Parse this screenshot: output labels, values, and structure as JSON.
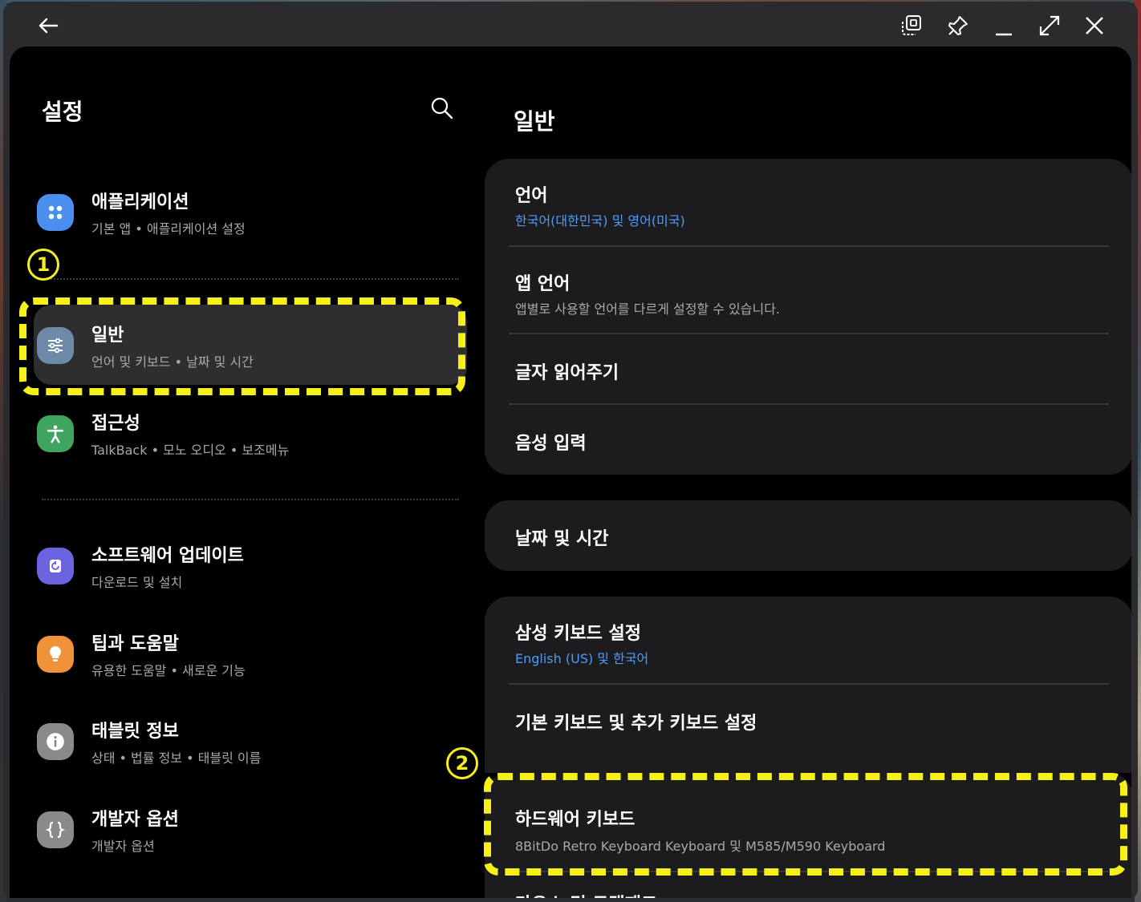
{
  "titlebar": {
    "icons": [
      "back-arrow-icon",
      "screenshot-window-icon",
      "pin-icon",
      "minimize-icon",
      "maximize-icon",
      "close-icon"
    ]
  },
  "left": {
    "title": "설정",
    "items": [
      {
        "title": "애플리케이션",
        "subtitle": "기본 앱  •  애플리케이션 설정",
        "icon": "apps-icon",
        "color": "#4a8ef0"
      },
      {
        "title": "일반",
        "subtitle": "언어 및 키보드  •  날짜 및 시간",
        "icon": "sliders-icon",
        "color": "#6f8aa8"
      },
      {
        "title": "접근성",
        "subtitle": "TalkBack  •  모노 오디오  •  보조메뉴",
        "icon": "accessibility-icon",
        "color": "#3fa45f"
      },
      {
        "title": "소프트웨어 업데이트",
        "subtitle": "다운로드 및 설치",
        "icon": "update-icon",
        "color": "#6b63e0"
      },
      {
        "title": "팁과 도움말",
        "subtitle": "유용한 도움말  •  새로운 기능",
        "icon": "lightbulb-icon",
        "color": "#f0923a"
      },
      {
        "title": "태블릿 정보",
        "subtitle": "상태  •  법률 정보  •  태블릿 이름",
        "icon": "info-icon",
        "color": "#8a8a8a"
      },
      {
        "title": "개발자 옵션",
        "subtitle": "개발자 옵션",
        "icon": "braces-icon",
        "color": "#8a8a8a"
      }
    ]
  },
  "right": {
    "title": "일반",
    "rows": [
      {
        "title": "언어",
        "subtitle": "한국어(대한민국) 및 영어(미국)"
      },
      {
        "title": "앱 언어",
        "subtitle": "앱별로 사용할 언어를 다르게 설정할 수 있습니다."
      },
      {
        "title": "글자 읽어주기"
      },
      {
        "title": "음성 입력"
      },
      {
        "title": "날짜 및 시간"
      },
      {
        "title": "삼성 키보드 설정",
        "subtitle": "English (US) 및 한국어"
      },
      {
        "title": "기본 키보드 및 추가 키보드 설정"
      },
      {
        "title": "하드웨어 키보드",
        "subtitle": "8BitDo Retro Keyboard Keyboard 및 M585/M590 Keyboard"
      },
      {
        "title": "마우스 및 트랙패드"
      }
    ]
  },
  "annotations": {
    "badge1": "1",
    "badge2": "2",
    "color": "#f5ef1a"
  }
}
